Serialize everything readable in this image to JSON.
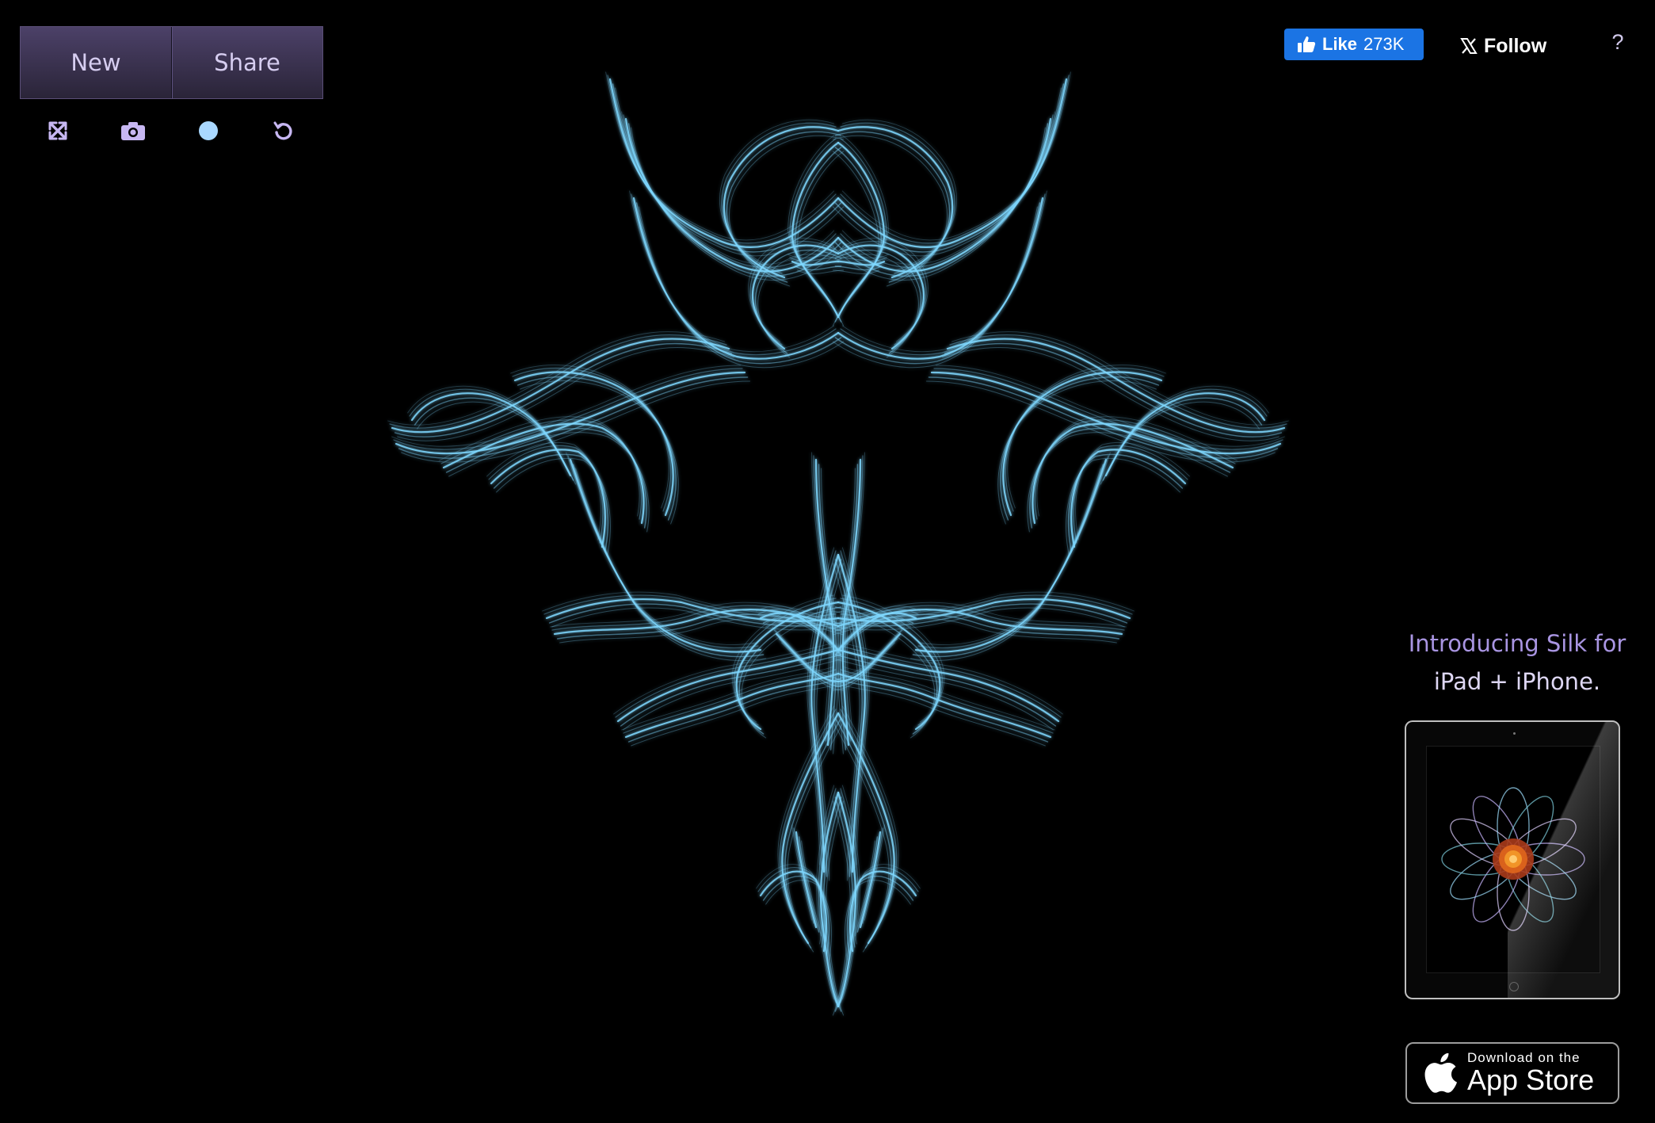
{
  "toolbar": {
    "new_label": "New",
    "share_label": "Share",
    "tools": [
      "fullscreen-icon",
      "camera-icon",
      "color-dot-icon",
      "undo-icon"
    ],
    "accent_color": "#c7b7f2",
    "dot_color": "#a9d8ff"
  },
  "social": {
    "like_label": "Like",
    "like_count": "273K",
    "follow_label": "Follow",
    "help_label": "?"
  },
  "promo": {
    "line1": "Introducing Silk for",
    "line2": "iPad + iPhone."
  },
  "appstore": {
    "small": "Download on the",
    "big": "App Store"
  },
  "artwork": {
    "stroke_color": "#7fd8ff",
    "background": "#000000"
  }
}
